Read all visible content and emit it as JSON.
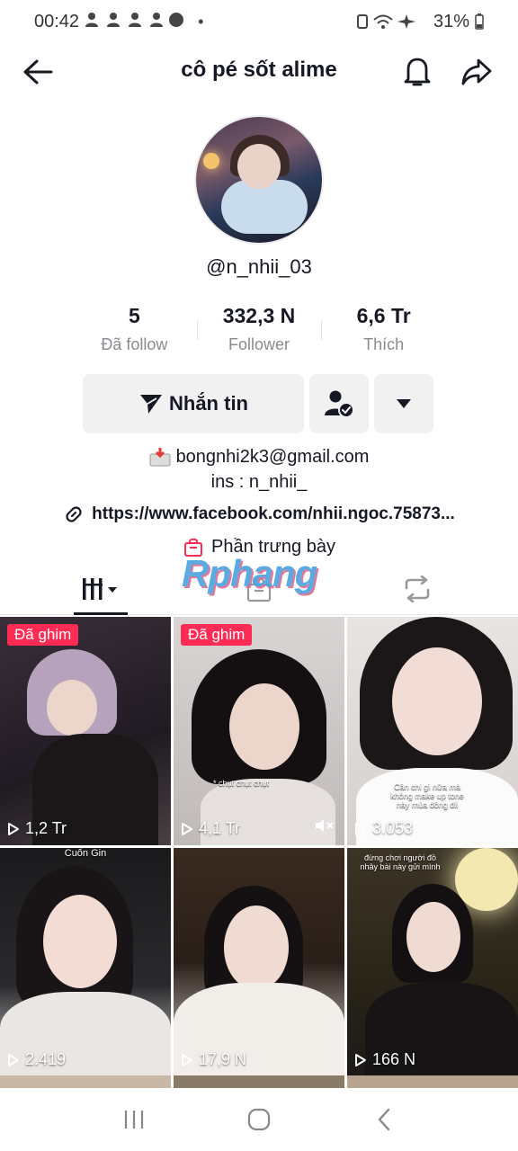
{
  "status_bar": {
    "time": "00:42",
    "battery": "31%"
  },
  "header": {
    "title": "cô pé sốt alime"
  },
  "profile": {
    "username": "@n_nhii_03",
    "stats": [
      {
        "value": "5",
        "label": "Đã follow"
      },
      {
        "value": "332,3 N",
        "label": "Follower"
      },
      {
        "value": "6,6 Tr",
        "label": "Thích"
      }
    ],
    "message_button": "Nhắn tin",
    "bio_lines": [
      "bongnhi2k3@gmail.com",
      "ins : n_nhii_"
    ],
    "link": "https://www.facebook.com/nhii.ngoc.75873...",
    "showcase": "Phần trưng bày"
  },
  "watermark": "Rphang",
  "videos": [
    {
      "pinned": "Đã ghim",
      "views": "1,2 Tr",
      "caption": ""
    },
    {
      "pinned": "Đã ghim",
      "views": "4,1 Tr",
      "caption": "* chụt chụt chụt"
    },
    {
      "pinned": "",
      "views": "3.053",
      "caption": "Cần chi gì nữa mà không make up tone này mùa đông đii"
    },
    {
      "pinned": "",
      "views": "2.419",
      "caption": "Cuốn Gin"
    },
    {
      "pinned": "",
      "views": "17,9 N",
      "caption": ""
    },
    {
      "pinned": "",
      "views": "166 N",
      "caption": "đừng chơi người đồ nhây bài này gửi mình"
    }
  ],
  "colors": {
    "accent": "#fe2c55",
    "text": "#161823",
    "muted": "#8a8b91",
    "button_bg": "#f1f1f2"
  }
}
